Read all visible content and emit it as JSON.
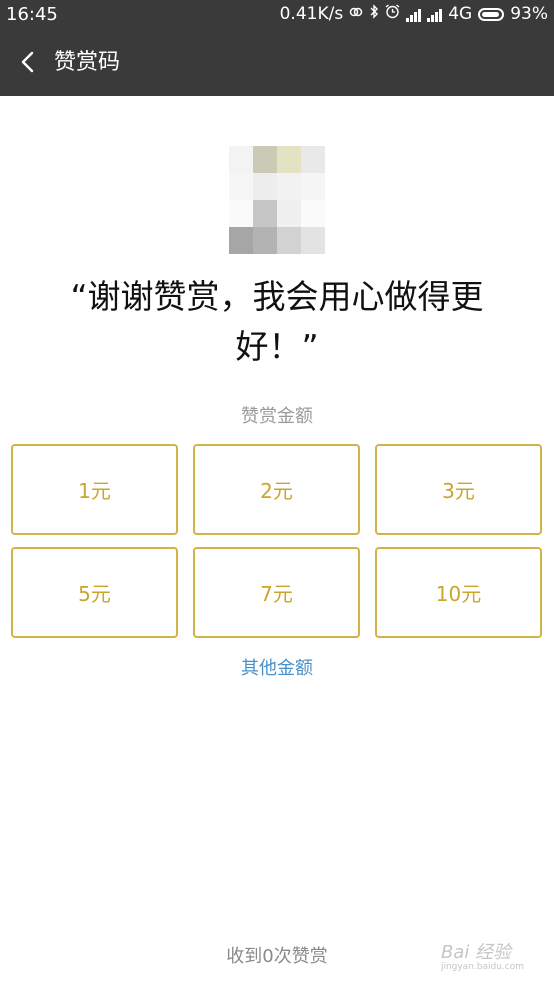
{
  "status_bar": {
    "time": "16:45",
    "net_speed": "0.41K/s",
    "network_type": "4G",
    "battery_percent": "93%",
    "battery_level": 0.93,
    "icons": [
      "link-icon",
      "bluetooth-icon",
      "alarm-icon",
      "signal-icon",
      "signal-icon",
      "battery-icon"
    ]
  },
  "nav": {
    "title": "赞赏码",
    "back_icon": "chevron-left-icon"
  },
  "thanks_message": "“谢谢赞赏，我会用心做得更好！”",
  "amount_label": "赞赏金额",
  "amounts": [
    {
      "label": "1元"
    },
    {
      "label": "2元"
    },
    {
      "label": "3元"
    },
    {
      "label": "5元"
    },
    {
      "label": "7元"
    },
    {
      "label": "10元"
    }
  ],
  "other_amount": "其他金额",
  "received": "收到0次赞赏",
  "watermark": {
    "text": "Bai 经验",
    "sub": "jingyan.baidu.com"
  },
  "colors": {
    "bar_bg": "#3a3a3a",
    "accent_gold": "#d4b24a",
    "link_blue": "#4a90c8"
  }
}
